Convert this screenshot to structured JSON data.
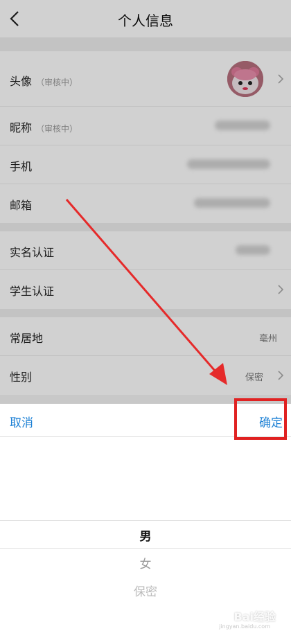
{
  "header": {
    "title": "个人信息"
  },
  "group1": {
    "avatar_label": "头像",
    "avatar_sub": "（审核中）",
    "nickname_label": "昵称",
    "nickname_sub": "（审核中）",
    "phone_label": "手机",
    "email_label": "邮箱"
  },
  "group2": {
    "realname_label": "实名认证",
    "student_label": "学生认证"
  },
  "group3": {
    "residence_label": "常居地",
    "residence_value": "亳州",
    "gender_label": "性别",
    "gender_value": "保密"
  },
  "sheet": {
    "cancel_label": "取消",
    "confirm_label": "确定",
    "options": [
      "男",
      "女",
      "保密"
    ],
    "selected_index": 0
  },
  "watermark": {
    "text": "Bai经验",
    "sub": "jingyan.baidu.com"
  },
  "colors": {
    "accent": "#1a7fd4",
    "highlight": "#e02222"
  }
}
